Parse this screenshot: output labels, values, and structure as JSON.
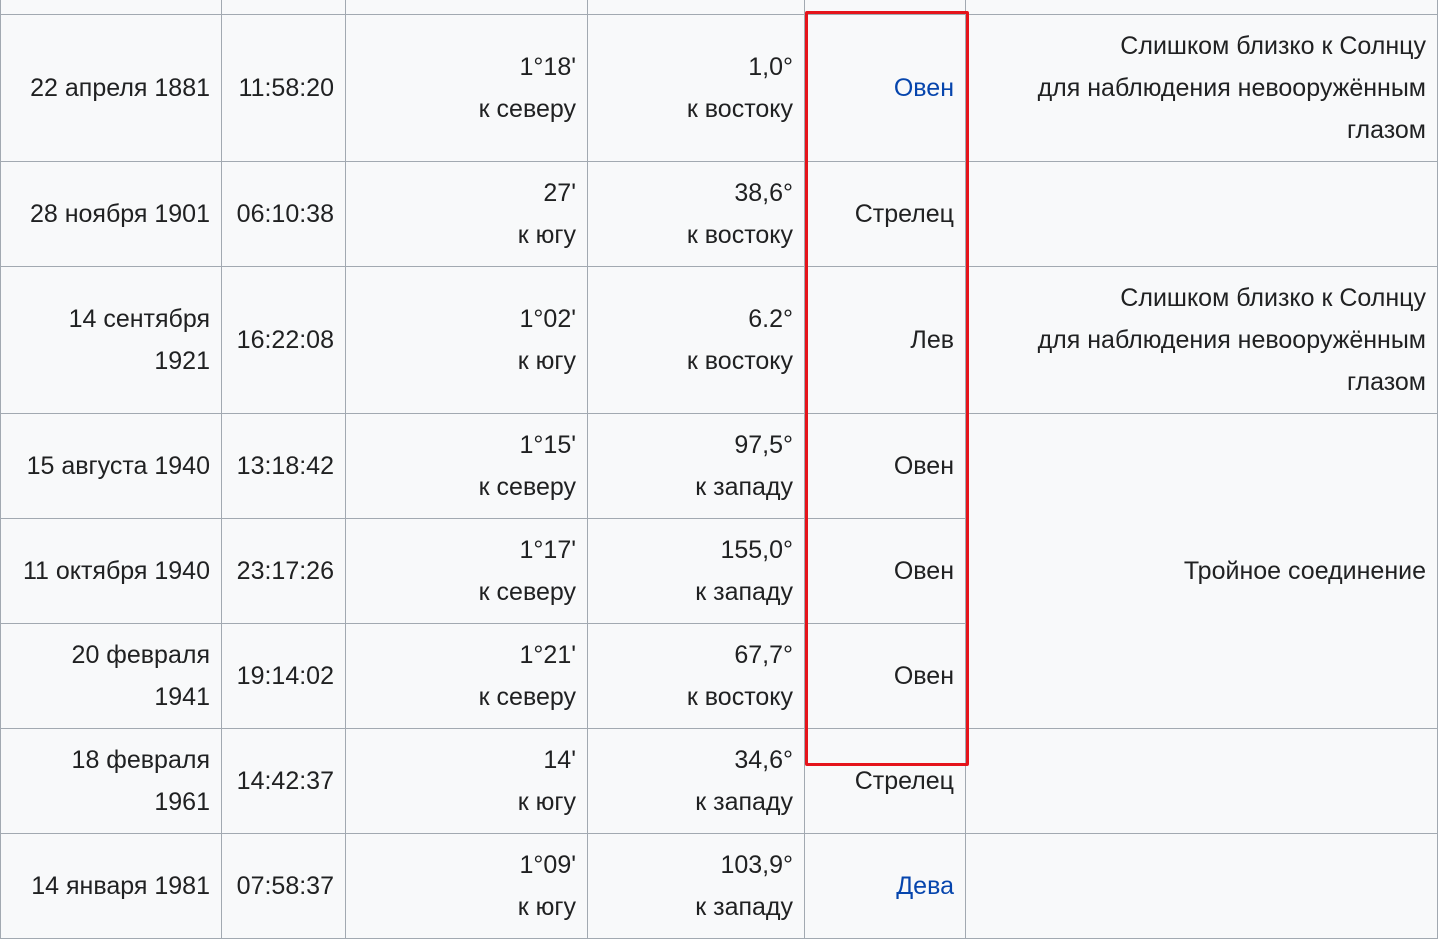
{
  "colors": {
    "link": "#0645ad",
    "highlight": "#e5141b",
    "cell_bg": "#f8f9fa",
    "border": "#a2a9b1"
  },
  "rows": [
    {
      "date": "",
      "time": "",
      "sep1": "",
      "sep2": "",
      "elong1": "",
      "elong2": "",
      "constellation": "",
      "is_link": false
    },
    {
      "date": "22 апреля 1881",
      "time": "11:58:20",
      "sep1": "1°18'",
      "sep2": "к северу",
      "elong1": "1,0°",
      "elong2": "к востоку",
      "constellation": "Овен",
      "is_link": true
    },
    {
      "date": "28 ноября 1901",
      "time": "06:10:38",
      "sep1": "27'",
      "sep2": "к югу",
      "elong1": "38,6°",
      "elong2": "к востоку",
      "constellation": "Стрелец",
      "is_link": false
    },
    {
      "date": "14 сентября 1921",
      "time": "16:22:08",
      "sep1": "1°02'",
      "sep2": "к югу",
      "elong1": "6.2°",
      "elong2": "к востоку",
      "constellation": "Лев",
      "is_link": false
    },
    {
      "date": "15 августа 1940",
      "time": "13:18:42",
      "sep1": "1°15'",
      "sep2": "к северу",
      "elong1": "97,5°",
      "elong2": "к западу",
      "constellation": "Овен",
      "is_link": false
    },
    {
      "date": "11 октября 1940",
      "time": "23:17:26",
      "sep1": "1°17'",
      "sep2": "к северу",
      "elong1": "155,0°",
      "elong2": "к западу",
      "constellation": "Овен",
      "is_link": false
    },
    {
      "date": "20 февраля 1941",
      "time": "19:14:02",
      "sep1": "1°21'",
      "sep2": "к северу",
      "elong1": "67,7°",
      "elong2": "к востоку",
      "constellation": "Овен",
      "is_link": false
    },
    {
      "date": "18 февраля 1961",
      "time": "14:42:37",
      "sep1": "14'",
      "sep2": "к югу",
      "elong1": "34,6°",
      "elong2": "к западу",
      "constellation": "Стрелец",
      "is_link": false
    },
    {
      "date": "14 января 1981",
      "time": "07:58:37",
      "sep1": "1°09'",
      "sep2": "к югу",
      "elong1": "103,9°",
      "elong2": "к западу",
      "constellation": "Дева",
      "is_link": true
    }
  ],
  "notes": {
    "too_close_1": [
      "Слишком близко к Солнцу",
      "для наблюдения невооружённым",
      "глазом"
    ],
    "too_close_2": [
      "Слишком близко к Солнцу",
      "для наблюдения невооружённым",
      "глазом"
    ],
    "triple": "Тройное соединение"
  }
}
